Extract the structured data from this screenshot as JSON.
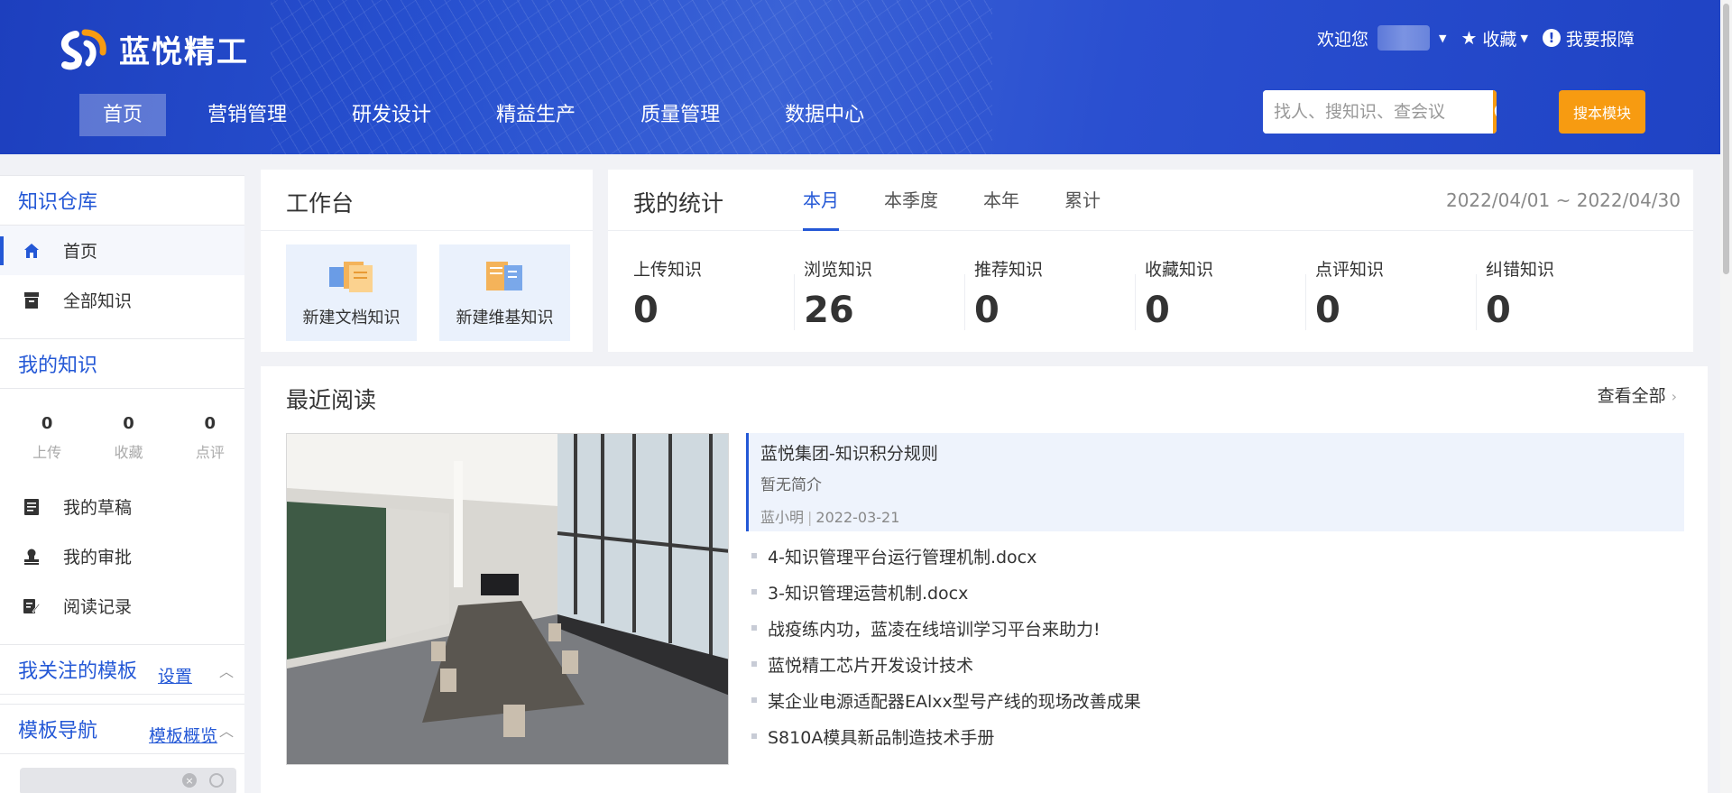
{
  "header": {
    "logo_text": "蓝悦精工",
    "nav": [
      {
        "label": "首页",
        "active": true
      },
      {
        "label": "营销管理"
      },
      {
        "label": "研发设计"
      },
      {
        "label": "精益生产"
      },
      {
        "label": "质量管理"
      },
      {
        "label": "数据中心"
      }
    ],
    "welcome": "欢迎您",
    "favorites": "收藏",
    "report": "我要报障",
    "search_placeholder": "找人、搜知识、查会议",
    "module_search": "搜本模块",
    "accent_color": "#f79b11",
    "brand_color": "#2446c7"
  },
  "sidebar": {
    "repo_title": "知识仓库",
    "home": "首页",
    "all_knowledge": "全部知识",
    "my_knowledge_title": "我的知识",
    "my_stats": [
      {
        "value": "0",
        "label": "上传"
      },
      {
        "value": "0",
        "label": "收藏"
      },
      {
        "value": "0",
        "label": "点评"
      }
    ],
    "drafts": "我的草稿",
    "approvals": "我的审批",
    "reading_log": "阅读记录",
    "followed_templates": "我关注的模板",
    "settings_link": "设置",
    "template_nav": "模板导航",
    "template_overview": "模板概览"
  },
  "workbench": {
    "title": "工作台",
    "new_doc": "新建文档知识",
    "new_wiki": "新建维基知识"
  },
  "stats": {
    "title": "我的统计",
    "tabs": [
      "本月",
      "本季度",
      "本年",
      "累计"
    ],
    "date_range": "2022/04/01 ~ 2022/04/30",
    "items": [
      {
        "label": "上传知识",
        "value": "0"
      },
      {
        "label": "浏览知识",
        "value": "26"
      },
      {
        "label": "推荐知识",
        "value": "0"
      },
      {
        "label": "收藏知识",
        "value": "0"
      },
      {
        "label": "点评知识",
        "value": "0"
      },
      {
        "label": "纠错知识",
        "value": "0"
      }
    ]
  },
  "recent": {
    "title": "最近阅读",
    "view_all": "查看全部",
    "featured": {
      "title": "蓝悦集团-知识积分规则",
      "desc": "暂无简介",
      "author": "蓝小明",
      "date": "2022-03-21"
    },
    "items": [
      "4-知识管理平台运行管理机制.docx",
      "3-知识管理运营机制.docx",
      "战疫练内功，蓝凌在线培训学习平台来助力!",
      "蓝悦精工芯片开发设计技术",
      "某企业电源适配器EAlxx型号产线的现场改善成果",
      "S810A模具新品制造技术手册"
    ]
  }
}
